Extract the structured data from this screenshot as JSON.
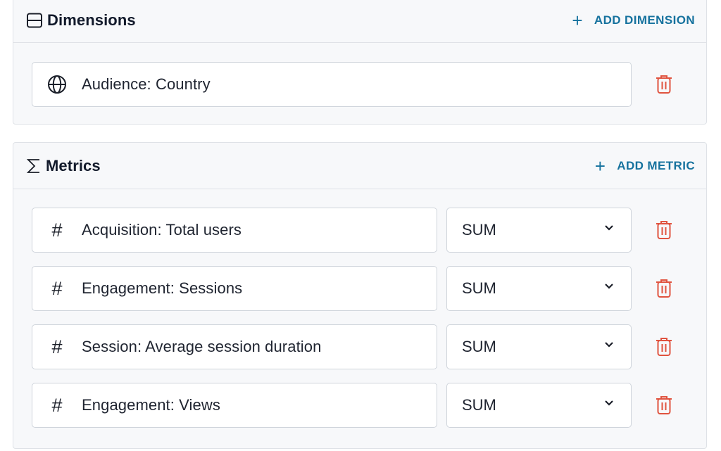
{
  "dimensions": {
    "title": "Dimensions",
    "title_icon": "dimension-icon",
    "add_label": "ADD DIMENSION",
    "items": [
      {
        "label": "Audience: Country",
        "icon": "globe-icon"
      }
    ]
  },
  "metrics": {
    "title": "Metrics",
    "title_icon": "sigma-icon",
    "add_label": "ADD METRIC",
    "items": [
      {
        "label": "Acquisition: Total users",
        "icon": "hash-icon",
        "aggregation": "SUM"
      },
      {
        "label": "Engagement: Sessions",
        "icon": "hash-icon",
        "aggregation": "SUM"
      },
      {
        "label": "Session: Average session duration",
        "icon": "hash-icon",
        "aggregation": "SUM"
      },
      {
        "label": "Engagement: Views",
        "icon": "hash-icon",
        "aggregation": "SUM"
      }
    ]
  },
  "colors": {
    "accent": "#16729e",
    "delete": "#e0533f",
    "panel_bg": "#f7f8fa",
    "border": "#dfe2e7"
  }
}
